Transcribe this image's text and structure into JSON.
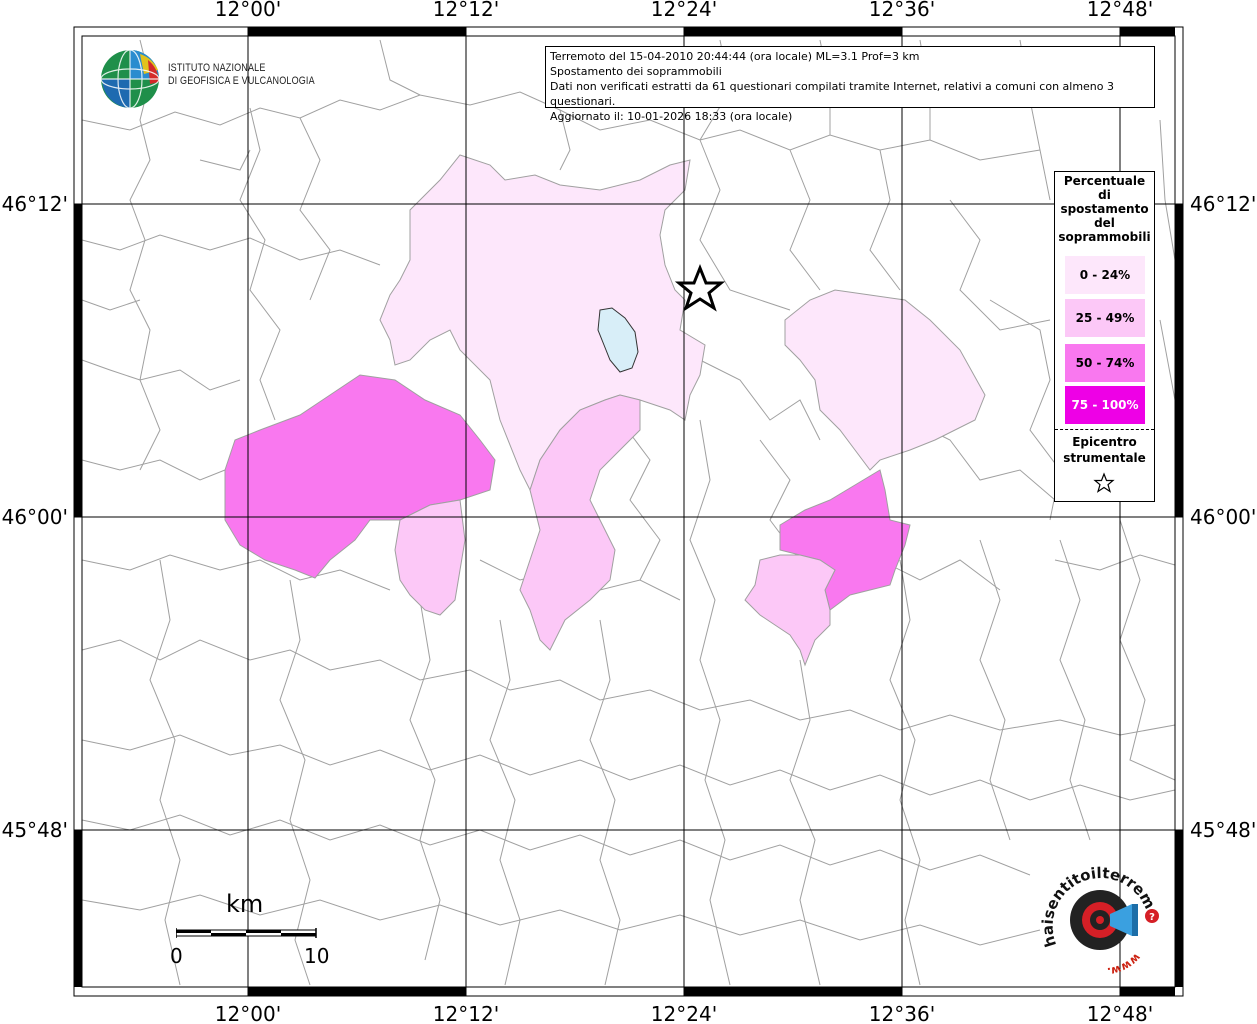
{
  "map": {
    "x_labels": [
      "12°00'",
      "12°12'",
      "12°24'",
      "12°36'",
      "12°48'"
    ],
    "y_labels": [
      "46°12'",
      "46°00'",
      "45°48'"
    ]
  },
  "info": {
    "line1": "Terremoto del 15-04-2010 20:44:44 (ora locale) ML=3.1 Prof=3 km",
    "line2": "Spostamento dei soprammobili",
    "line3": "Dati non verificati estratti da 61 questionari compilati tramite Internet, relativi a comuni con almeno 3 questionari.",
    "line4": "Aggiornato il: 10-01-2026 18:33 (ora locale)"
  },
  "legend": {
    "title_lines": [
      "Percentuale",
      "di",
      "spostamento",
      "del",
      "soprammobili"
    ],
    "items": [
      {
        "label": "0 - 24%",
        "color": "#fde7fb",
        "text_color": "#000000"
      },
      {
        "label": "25 - 49%",
        "color": "#fcc8f7",
        "text_color": "#000000"
      },
      {
        "label": "50 - 74%",
        "color": "#f978ef",
        "text_color": "#000000"
      },
      {
        "label": "75 - 100%",
        "color": "#ee00e6",
        "text_color": "#ffffff"
      }
    ],
    "epicenter_lines": [
      "Epicentro",
      "strumentale"
    ]
  },
  "logo": {
    "line1": "ISTITUTO NAZIONALE",
    "line2": "DI GEOFISICA E VULCANOLOGIA"
  },
  "scale": {
    "unit": "km",
    "min_label": "0",
    "max_label": "10"
  },
  "sentito": {
    "text": "haisentitoilterremoto.it",
    "url": "www."
  },
  "colors": {
    "lake": "#d8eef8",
    "boundary": "#9a9a9a",
    "grid": "#000000",
    "frame": "#000000"
  }
}
